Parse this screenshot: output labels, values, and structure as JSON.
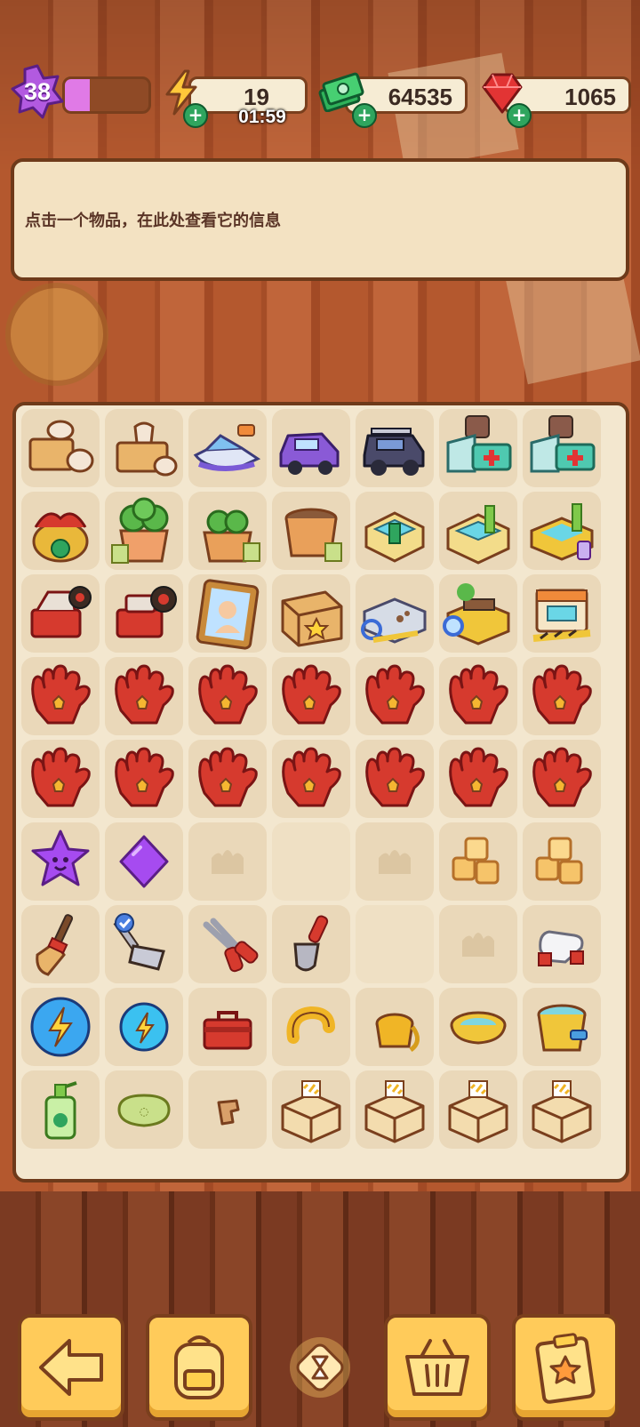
{
  "hud": {
    "level": "38",
    "xp_progress": 0.3,
    "energy": "19",
    "energy_timer": "01:59",
    "cash": "64535",
    "gems": "1065"
  },
  "info_panel": {
    "hint": "点击一个物品，在此处查看它的信息"
  },
  "colors": {
    "board_bg": "#f3e7cf",
    "cell_bg": "#ead8b9",
    "button_bg": "#ffcb5a",
    "outline": "#6e3a1a"
  },
  "board": {
    "rows": [
      [
        "pottery-cart",
        "pottery-stand",
        "jet-ski",
        "purple-car",
        "offroad-jeep",
        "first-aid-kit",
        "first-aid-kit"
      ],
      [
        "dragon-vase",
        "potted-plant-large",
        "potted-plant",
        "soil-pot",
        "water-tank",
        "water-tank-lever",
        "golden-bathtub"
      ],
      [
        "toolbox-red-open",
        "red-drill",
        "portrait-frame",
        "magic-chest",
        "paw-print-board",
        "bench-magnifier",
        "shop-stall"
      ],
      [
        "red-glove",
        "red-glove",
        "red-glove",
        "red-glove",
        "red-glove",
        "red-glove",
        "red-glove"
      ],
      [
        "red-glove",
        "red-glove",
        "red-glove",
        "red-glove",
        "red-glove",
        "red-glove",
        "red-glove"
      ],
      [
        "purple-star-smile",
        "purple-gem",
        "empty-slot",
        "empty",
        "empty-slot",
        "sugar-cubes",
        "sugar-cubes"
      ],
      [
        "broom",
        "garden-rake",
        "pruning-shears",
        "trowel",
        "empty",
        "empty-slot",
        "white-gloves"
      ],
      [
        "energy-orb-large",
        "energy-orb",
        "red-toolbox",
        "yellow-pipe",
        "yellow-bucket-hose",
        "yellow-bowl",
        "yellow-bucket"
      ],
      [
        "soap-bottle",
        "green-soap",
        "wooden-piece",
        "construction-crate",
        "construction-crate",
        "construction-crate",
        "construction-crate"
      ]
    ]
  },
  "bottom_bar": {
    "buttons": [
      "back-arrow-icon",
      "backpack-icon",
      "basket-icon",
      "clipboard-star-icon"
    ],
    "center": "hourglass-icon"
  }
}
